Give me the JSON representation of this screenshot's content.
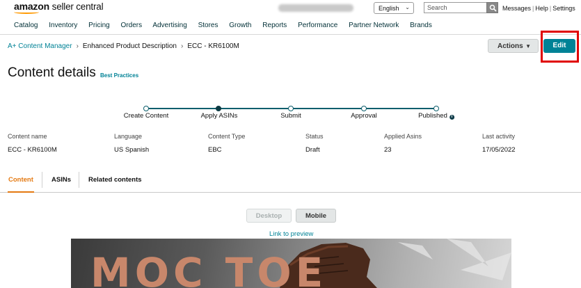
{
  "header": {
    "logo_brand": "amazon",
    "logo_product": "seller central",
    "language": "English",
    "search_placeholder": "Search",
    "links": [
      "Messages",
      "Help",
      "Settings"
    ]
  },
  "nav": [
    "Catalog",
    "Inventory",
    "Pricing",
    "Orders",
    "Advertising",
    "Stores",
    "Growth",
    "Reports",
    "Performance",
    "Partner Network",
    "Brands"
  ],
  "breadcrumb": [
    "A+ Content Manager",
    "Enhanced Product Description",
    "ECC - KR6100M"
  ],
  "toolbar": {
    "actions_label": "Actions",
    "edit_label": "Edit"
  },
  "page": {
    "title": "Content details",
    "best_practices": "Best Practices"
  },
  "steps": [
    {
      "label": "Create Content",
      "state": "done"
    },
    {
      "label": "Apply ASINs",
      "state": "current"
    },
    {
      "label": "Submit",
      "state": "pending"
    },
    {
      "label": "Approval",
      "state": "pending"
    },
    {
      "label": "Published",
      "state": "pending",
      "info_icon": "info-icon"
    }
  ],
  "details": [
    {
      "label": "Content name",
      "value": "ECC - KR6100M"
    },
    {
      "label": "Language",
      "value": "US Spanish"
    },
    {
      "label": "Content Type",
      "value": "EBC"
    },
    {
      "label": "Status",
      "value": "Draft"
    },
    {
      "label": "Applied Asins",
      "value": "23"
    },
    {
      "label": "Last activity",
      "value": "17/05/2022"
    }
  ],
  "tabs": [
    {
      "label": "Content",
      "active": true
    },
    {
      "label": "ASINs",
      "active": false
    },
    {
      "label": "Related contents",
      "active": false
    }
  ],
  "preview": {
    "desktop_label": "Desktop",
    "mobile_label": "Mobile",
    "link_label": "Link to preview"
  },
  "banner": {
    "text": "MOC TOE"
  },
  "colors": {
    "accent": "#008296",
    "active_tab": "#e47911",
    "highlight": "#e00000",
    "step": "#0c5e6c"
  }
}
